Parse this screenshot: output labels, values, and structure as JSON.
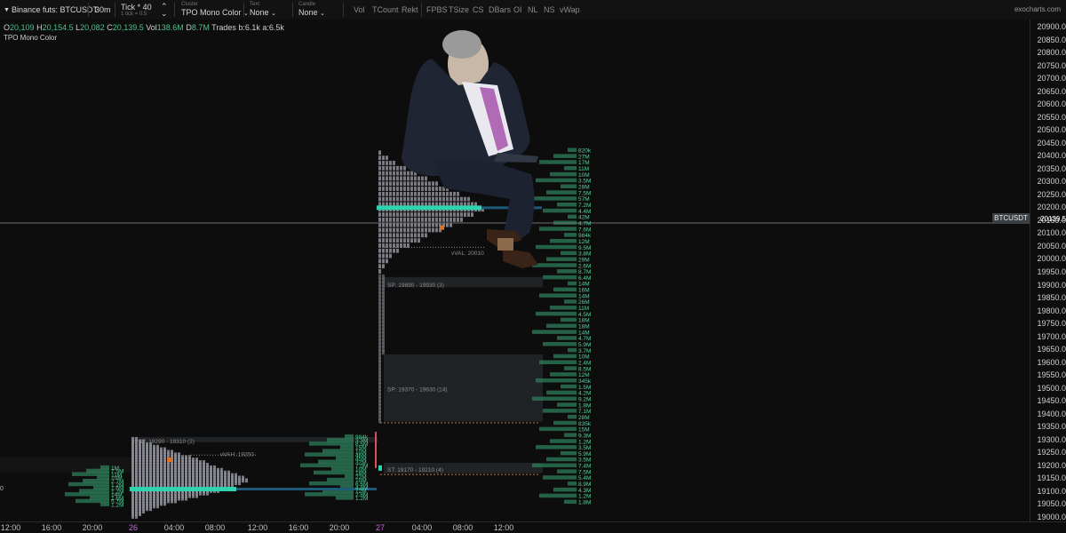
{
  "toolbar": {
    "symbol": "Binance futs: BTCUSDT",
    "timeframe": "30m",
    "tick_label": "Tick * 40",
    "tick_sub": "1 tick = 0.5",
    "cluster_caption": "Cluster",
    "cluster_value": "TPO Mono Color",
    "text_caption": "Text",
    "text_value": "None",
    "candle_caption": "Candle",
    "candle_value": "None",
    "tools": [
      "Vol",
      "TCount",
      "Rekt",
      "FPBS",
      "TSize",
      "CS",
      "DBars",
      "OI",
      "NL",
      "NS",
      "vWap"
    ],
    "brand": "exocharts.com"
  },
  "ohlc": {
    "o_label": "O",
    "o": "20,109",
    "h_label": "H",
    "h": "20,154.5",
    "l_label": "L",
    "l": "20,082",
    "c_label": "C",
    "c": "20,139.5",
    "vol_label": "Vol",
    "vol": "138.6M",
    "d_label": "D",
    "d": "8.7M",
    "trades": "Trades b:6.1k a:6.5k"
  },
  "indicator": "TPO Mono Color",
  "price_axis": [
    "20900.0",
    "20850.0",
    "20800.0",
    "20750.0",
    "20700.0",
    "20650.0",
    "20600.0",
    "20550.0",
    "20500.0",
    "20450.0",
    "20400.0",
    "20350.0",
    "20300.0",
    "20250.0",
    "20200.0",
    "20150.0",
    "20100.0",
    "20050.0",
    "20000.0",
    "19950.0",
    "19900.0",
    "19850.0",
    "19800.0",
    "19750.0",
    "19700.0",
    "19650.0",
    "19600.0",
    "19550.0",
    "19500.0",
    "19450.0",
    "19400.0",
    "19350.0",
    "19300.0",
    "19250.0",
    "19200.0",
    "19150.0",
    "19100.0",
    "19050.0",
    "19000.0"
  ],
  "current_price": {
    "symbol": "BTCUSDT",
    "value": "20139.5"
  },
  "time_axis": [
    {
      "label": "12:00",
      "day": false
    },
    {
      "label": "16:00",
      "day": false
    },
    {
      "label": "20:00",
      "day": false
    },
    {
      "label": "26",
      "day": true
    },
    {
      "label": "04:00",
      "day": false
    },
    {
      "label": "08:00",
      "day": false
    },
    {
      "label": "12:00",
      "day": false
    },
    {
      "label": "16:00",
      "day": false
    },
    {
      "label": "20:00",
      "day": false
    },
    {
      "label": "27",
      "day": true
    },
    {
      "label": "04:00",
      "day": false
    },
    {
      "label": "08:00",
      "day": false
    },
    {
      "label": "12:00",
      "day": false
    }
  ],
  "annotations": {
    "val": "vVAL: 20010",
    "sp1": "SP: 19890 - 19930 (3)",
    "sp2": "SP: 19370 - 19630 (14)",
    "st1": "ST: 19290 - 19310 (2)",
    "vah": "vVAH: 19250",
    "st2": "ST: 19170 - 19210 (4)",
    "zero": "0"
  },
  "volumes_day26": [
    "984k",
    "3.3M",
    "8.5M",
    "15M",
    "10M",
    "46M",
    "45M",
    "32M",
    "7.0M",
    "10M",
    "18M",
    "22M",
    "10M",
    "6.6M",
    "4.8M",
    "12M",
    "2.8M",
    "1.2M"
  ],
  "volumes_day25": [
    "1M",
    "7.5M",
    "11M",
    "10M",
    "2.7M",
    "1.2M",
    "1.6M",
    "1.7M",
    "14M",
    "1.6M",
    "5.7M",
    "1.2M"
  ],
  "volumes_day27": [
    "820k",
    "27M",
    "17M",
    "11M",
    "10M",
    "3.5M",
    "28M",
    "7.5M",
    "57M",
    "7.2M",
    "4.4M",
    "42M",
    "4.7M",
    "7.6M",
    "984k",
    "12M",
    "9.5M",
    "3.8M",
    "29M",
    "2.6M",
    "8.7M",
    "6.4M",
    "14M",
    "16M",
    "14M",
    "26M",
    "11M",
    "4.5M",
    "18M",
    "18M",
    "14M",
    "4.7M",
    "5.9M",
    "3.7M",
    "10M",
    "2.4M",
    "8.5M",
    "12M",
    "345k",
    "1.5M",
    "4.2M",
    "9.2M",
    "1.8M",
    "7.1M",
    "28M",
    "835k",
    "15M",
    "9.3M",
    "1.2M",
    "3.5M",
    "5.9M",
    "3.5M",
    "7.4M",
    "7.5M",
    "5.4M",
    "8.9M",
    "4.3M",
    "1.2M",
    "1.8M"
  ],
  "colors": {
    "background": "#0d0d0d",
    "tpo": "#8e8e96",
    "poc": "#2ed4b0",
    "volume": "#2e7d5a",
    "volume_text": "#4fd49a",
    "single_print": "#1f2326",
    "marker": "#e87018",
    "candle_red": "#e05050"
  },
  "icons": [
    "chevron-down-icon",
    "up-down-arrows-icon"
  ]
}
